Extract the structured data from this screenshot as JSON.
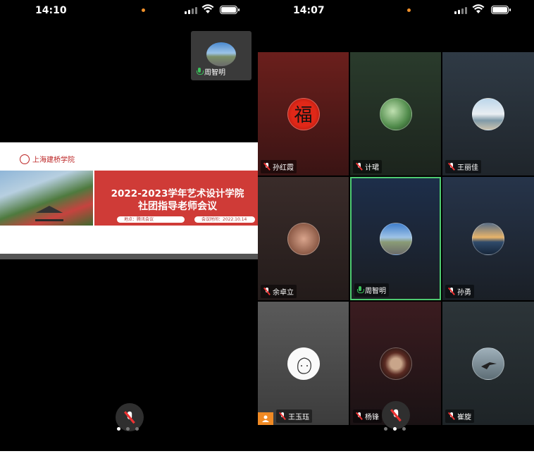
{
  "left_phone": {
    "status_time": "14:10",
    "thumbnail": {
      "name": "周智明"
    },
    "slide": {
      "logo_text": "上海建桥学院",
      "title_line1": "2022-2023学年艺术设计学院",
      "title_line2": "社团指导老师会议",
      "location": "地点：腾讯会议",
      "meeting_time": "会议时间：2022.10.14"
    },
    "pager": {
      "pages": 3,
      "active": 0
    }
  },
  "right_phone": {
    "status_time": "14:07",
    "participants": [
      {
        "name": "孙红霞",
        "mic": "muted",
        "avatar": "fu-character"
      },
      {
        "name": "计珺",
        "mic": "muted",
        "avatar": "green-plant"
      },
      {
        "name": "王丽佳",
        "mic": "muted",
        "avatar": "beach-figures"
      },
      {
        "name": "余卓立",
        "mic": "muted",
        "avatar": "hands"
      },
      {
        "name": "周智明",
        "mic": "active",
        "avatar": "road-sky"
      },
      {
        "name": "孙勇",
        "mic": "muted",
        "avatar": "sunset-clouds"
      },
      {
        "name": "王玉珏",
        "mic": "muted",
        "avatar": "sketch-face",
        "camera_badge": true
      },
      {
        "name": "杨锋",
        "mic": "muted",
        "avatar": "framed-photo"
      },
      {
        "name": "崔旋",
        "mic": "muted",
        "avatar": "bird-water"
      }
    ],
    "pager": {
      "pages": 3,
      "active": 1
    }
  },
  "colors": {
    "accent_green": "#4ecb71",
    "slide_red": "#cf3b37",
    "orange": "#f08a24"
  }
}
